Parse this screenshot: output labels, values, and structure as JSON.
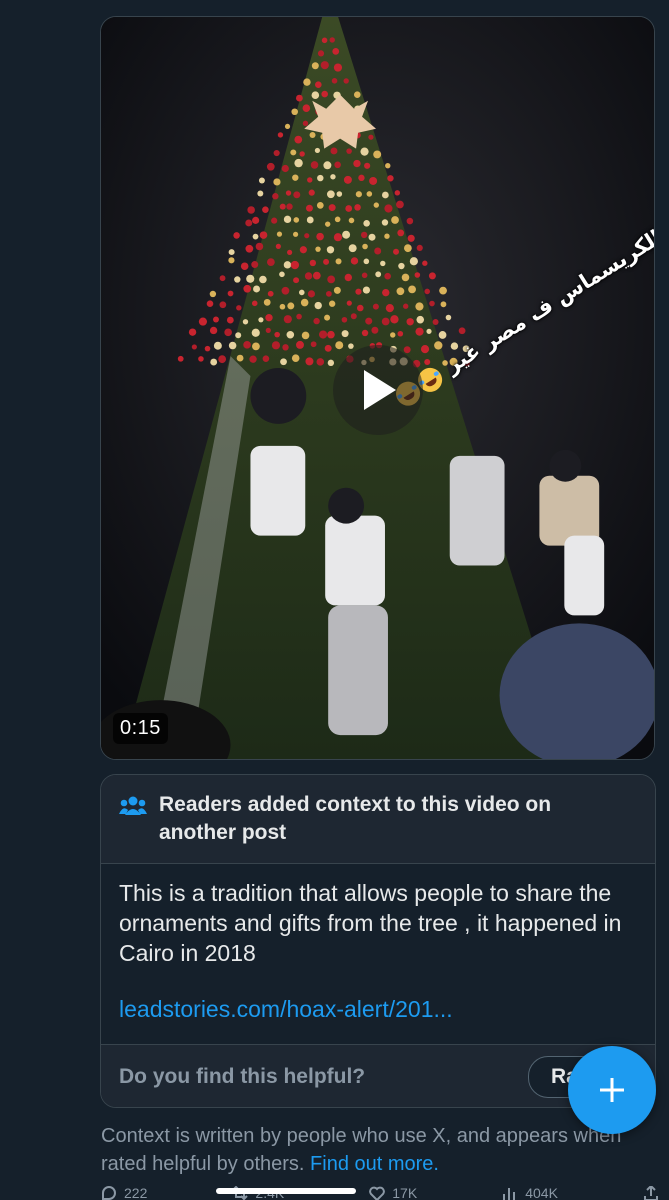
{
  "video": {
    "duration": "0:15",
    "overlay_caption": "الكريسماس ف مصر غير"
  },
  "community_note": {
    "title": "Readers added context to this video on another post",
    "body": "This is a tradition that allows people to share the ornaments and gifts from the tree , it happened in Cairo in 2018",
    "link": "leadstories.com/hoax-alert/201...",
    "question": "Do you find this helpful?",
    "rate_label": "Ra"
  },
  "disclaimer": {
    "text": "Context is written by people who use X, and appears when rated helpful by others.",
    "link": "Find out more."
  },
  "actions": {
    "replies": "222",
    "reposts": "2.4K",
    "likes": "17K",
    "views": "404K"
  },
  "colors": {
    "background": "#15202b",
    "accent": "#1d9bf0",
    "border": "#38444d",
    "muted_text": "#8b98a5"
  }
}
